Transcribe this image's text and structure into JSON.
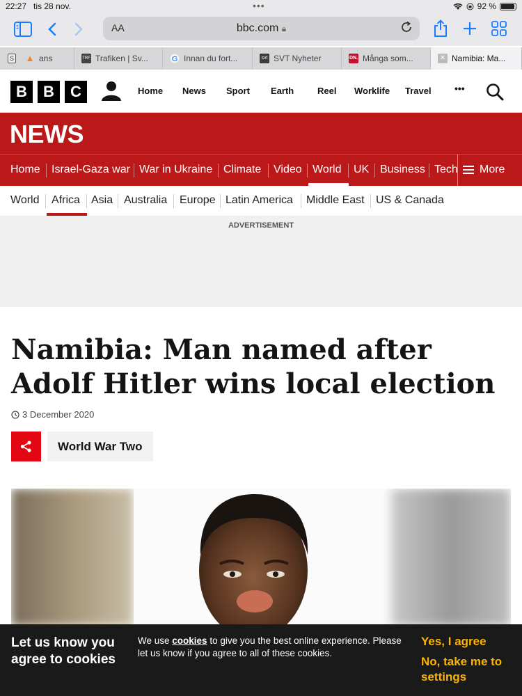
{
  "status": {
    "time": "22:27",
    "date": "tis 28 nov.",
    "battery": "92 %"
  },
  "browser": {
    "aa_label": "AA",
    "url": "bbc.com",
    "tabs": [
      {
        "label": "ans",
        "favicon_color": "#f58220"
      },
      {
        "label": "Trafiken | Sv...",
        "favicon_color": "#444444"
      },
      {
        "label": "Innan du fort...",
        "favicon_color": "#ffffff"
      },
      {
        "label": "SVT Nyheter",
        "favicon_color": "#3c3c3c"
      },
      {
        "label": "Många som...",
        "favicon_color": "#c8102e"
      },
      {
        "label": "Namibia: Ma...",
        "favicon_color": "#888888"
      }
    ]
  },
  "bbc": {
    "logo_letters": [
      "B",
      "B",
      "C"
    ],
    "nav": [
      "Home",
      "News",
      "Sport",
      "Earth",
      "Reel",
      "Worklife",
      "Travel"
    ],
    "more_dots": "•••"
  },
  "news_banner": {
    "title": "NEWS",
    "accent": "#bb1919"
  },
  "main_nav": {
    "items": [
      "Home",
      "Israel-Gaza war",
      "War in Ukraine",
      "Climate",
      "Video",
      "World",
      "UK",
      "Business",
      "Tech"
    ],
    "active": "World",
    "more": "More"
  },
  "sub_nav": {
    "items": [
      "World",
      "Africa",
      "Asia",
      "Australia",
      "Europe",
      "Latin America",
      "Middle East",
      "US & Canada"
    ],
    "active": "Africa"
  },
  "ad": {
    "label": "ADVERTISEMENT"
  },
  "article": {
    "headline": "Namibia: Man named after Adolf Hitler wins local election",
    "date": "3 December 2020",
    "tag": "World War Two"
  },
  "cookie": {
    "heading": "Let us know you agree to cookies",
    "text_before": "We use ",
    "text_link": "cookies",
    "text_after": " to give you the best online experience. Please let us know if you agree to all of these cookies.",
    "yes": "Yes, I agree",
    "no": "No, take me to settings"
  }
}
